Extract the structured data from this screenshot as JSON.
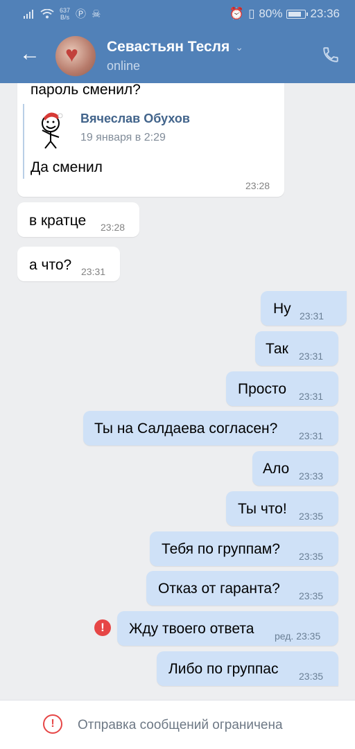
{
  "status_bar": {
    "net_speed_value": "637",
    "net_speed_unit": "B/s",
    "battery": "80%",
    "battery_level": 0.8,
    "time": "23:36"
  },
  "header": {
    "name": "Севастьян Тесля",
    "presence": "online"
  },
  "chat": {
    "forwarded_card": {
      "top_text": "пароль сменил?",
      "author": "Вячеслав Обухов",
      "date": "19 января в 2:29",
      "reply": "Да сменил",
      "time": "23:28"
    },
    "messages": [
      {
        "text": "в кратце",
        "time": "23:28",
        "dir": "in"
      },
      {
        "text": "а что?",
        "time": "23:31",
        "dir": "in"
      },
      {
        "text": "Ну",
        "time": "23:31",
        "dir": "out"
      },
      {
        "text": "Так",
        "time": "23:31",
        "dir": "out"
      },
      {
        "text": "Просто",
        "time": "23:31",
        "dir": "out"
      },
      {
        "text": "Ты на Салдаева согласен?",
        "time": "23:31",
        "dir": "out"
      },
      {
        "text": "Ало",
        "time": "23:33",
        "dir": "out"
      },
      {
        "text": "Ты что!",
        "time": "23:35",
        "dir": "out"
      },
      {
        "text": "Тебя по группам?",
        "time": "23:35",
        "dir": "out"
      },
      {
        "text": "Отказ от гаранта?",
        "time": "23:35",
        "dir": "out"
      },
      {
        "text": "Жду твоего ответа",
        "time": "ред. 23:35",
        "dir": "out",
        "error": true
      },
      {
        "text": "Либо по группас",
        "time": "23:35",
        "dir": "out"
      }
    ]
  },
  "footer": {
    "restriction_text": "Отправка сообщений ограничена"
  },
  "colors": {
    "header_bg": "#5181b8",
    "incoming_bubble": "#ffffff",
    "outgoing_bubble": "#cfe1f7",
    "error_red": "#e64646",
    "chat_bg": "#edeef0"
  },
  "icons": [
    "signal-icon",
    "wifi-icon",
    "vpn-icon",
    "skull-icon",
    "alarm-icon",
    "vibrate-icon",
    "battery-icon",
    "back-arrow-icon",
    "chevron-down-icon",
    "phone-icon",
    "error-icon"
  ]
}
